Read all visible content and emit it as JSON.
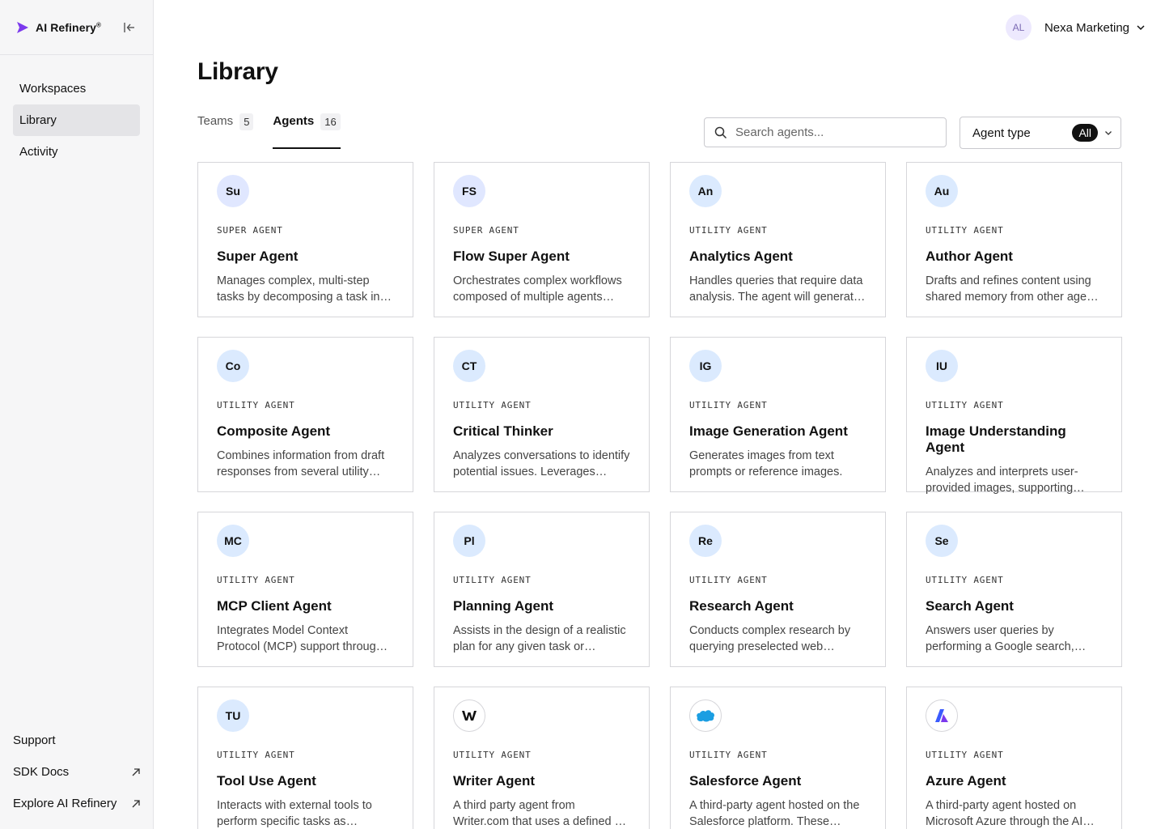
{
  "brand": {
    "name": "AI Refinery",
    "mark": "®"
  },
  "sidebar": {
    "items": [
      {
        "label": "Workspaces"
      },
      {
        "label": "Library"
      },
      {
        "label": "Activity"
      }
    ],
    "bottom": [
      {
        "label": "Support"
      },
      {
        "label": "SDK Docs"
      },
      {
        "label": "Explore AI Refinery"
      }
    ]
  },
  "header": {
    "avatar_initials": "AL",
    "org_name": "Nexa Marketing"
  },
  "page": {
    "title": "Library"
  },
  "tabs": [
    {
      "label": "Teams",
      "count": "5"
    },
    {
      "label": "Agents",
      "count": "16"
    }
  ],
  "search": {
    "placeholder": "Search agents..."
  },
  "filter": {
    "label": "Agent type",
    "value": "All"
  },
  "colors": {
    "accent": "#7c3aed",
    "avatar_bg": "#dbeafe",
    "active_nav": "#e4e4e7"
  },
  "cards": [
    {
      "initials": "Su",
      "type": "SUPER AGENT",
      "name": "Super Agent",
      "desc": "Manages complex, multi-step tasks by decomposing a task into smaller, manageable subtasks."
    },
    {
      "initials": "FS",
      "type": "SUPER AGENT",
      "name": "Flow Super Agent",
      "desc": "Orchestrates complex workflows composed of multiple agents working together."
    },
    {
      "initials": "An",
      "type": "UTILITY AGENT",
      "name": "Analytics Agent",
      "desc": "Handles queries that require data analysis. The agent will generate and execute code."
    },
    {
      "initials": "Au",
      "type": "UTILITY AGENT",
      "name": "Author Agent",
      "desc": "Drafts and refines content using shared memory from other agents in the team."
    },
    {
      "initials": "Co",
      "type": "UTILITY AGENT",
      "name": "Composite Agent",
      "desc": "Combines information from draft responses from several utility agents into one answer."
    },
    {
      "initials": "CT",
      "type": "UTILITY AGENT",
      "name": "Critical Thinker",
      "desc": "Analyzes conversations to identify potential issues. Leverages critical reasoning."
    },
    {
      "initials": "IG",
      "type": "UTILITY AGENT",
      "name": "Image Generation Agent",
      "desc": "Generates images from text prompts or reference images."
    },
    {
      "initials": "IU",
      "type": "UTILITY AGENT",
      "name": "Image Understanding Agent",
      "desc": "Analyzes and interprets user-provided images, supporting questions about their content."
    },
    {
      "initials": "MC",
      "type": "UTILITY AGENT",
      "name": "MCP Client Agent",
      "desc": "Integrates Model Context Protocol (MCP) support through connected servers and tools."
    },
    {
      "initials": "Pl",
      "type": "UTILITY AGENT",
      "name": "Planning Agent",
      "desc": "Assists in the design of a realistic plan for any given task or objective."
    },
    {
      "initials": "Re",
      "type": "UTILITY AGENT",
      "name": "Research Agent",
      "desc": "Conducts complex research by querying preselected web sources and documents."
    },
    {
      "initials": "Se",
      "type": "UTILITY AGENT",
      "name": "Search Agent",
      "desc": "Answers user queries by performing a Google search, gathering relevant results."
    },
    {
      "initials": "TU",
      "type": "UTILITY AGENT",
      "name": "Tool Use Agent",
      "desc": "Interacts with external tools to perform specific tasks as instructed by the user."
    },
    {
      "icon": "writer-logo-icon",
      "type": "UTILITY AGENT",
      "name": "Writer Agent",
      "desc": "A third  party agent from Writer.com that uses a defined set of tools and models."
    },
    {
      "icon": "salesforce-logo-icon",
      "type": "UTILITY AGENT",
      "name": "Salesforce Agent",
      "desc": "A third-party agent hosted on the Salesforce platform. These agents handle CRM tasks."
    },
    {
      "icon": "azure-logo-icon",
      "type": "UTILITY AGENT",
      "name": "Azure Agent",
      "desc": "A third-party agent hosted on Microsoft Azure through the AI Foundry service."
    }
  ]
}
